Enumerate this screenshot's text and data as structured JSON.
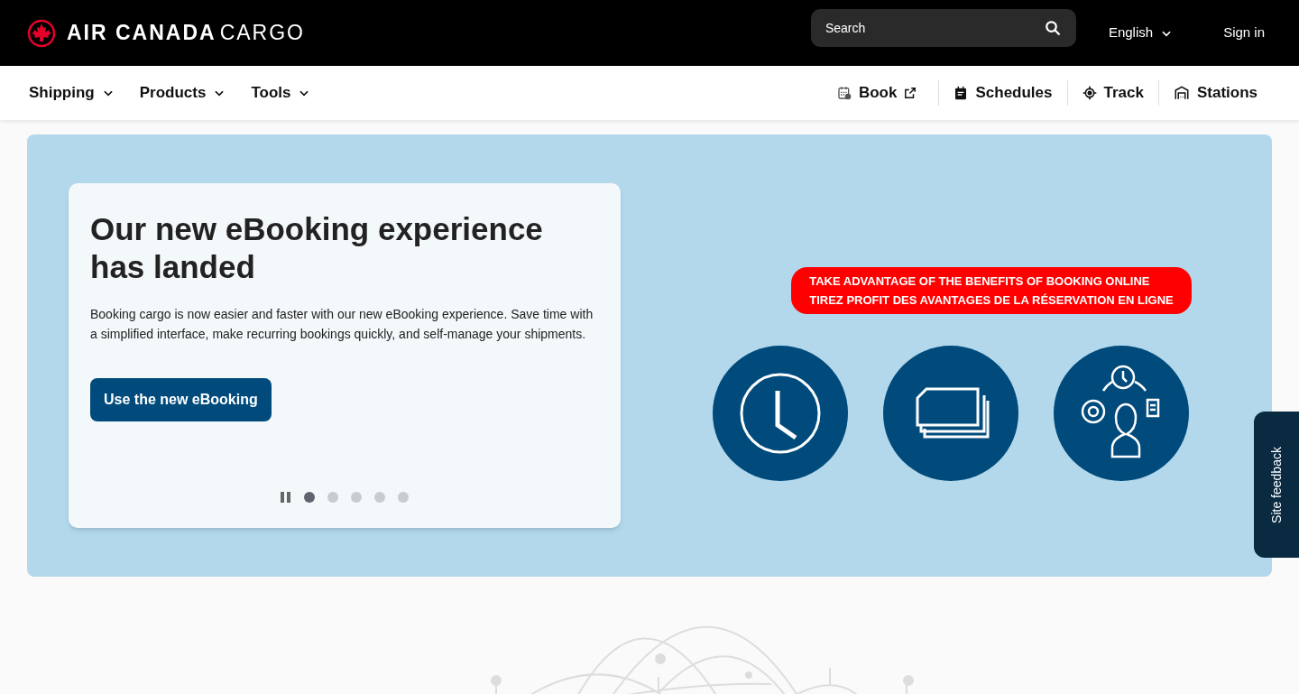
{
  "header": {
    "logo_text": "AIR CANADA",
    "logo_suffix": "CARGO",
    "search": {
      "placeholder": "Search"
    },
    "language": "English",
    "sign_in": "Sign in"
  },
  "nav": {
    "menus": [
      {
        "label": "Shipping"
      },
      {
        "label": "Products"
      },
      {
        "label": "Tools"
      }
    ],
    "links": [
      {
        "label": "Book",
        "kind": "book",
        "external": true
      },
      {
        "label": "Schedules",
        "kind": "schedules",
        "external": false
      },
      {
        "label": "Track",
        "kind": "track",
        "external": false
      },
      {
        "label": "Stations",
        "kind": "stations",
        "external": false
      }
    ]
  },
  "hero": {
    "title": "Our new eBooking experience has landed",
    "body": "Booking cargo is now easier and faster with our new eBooking experience. Save time with a simplified interface, make recurring bookings quickly, and self-manage your shipments.",
    "button": "Use the new eBooking",
    "slides": [
      {
        "selected": true
      },
      {
        "selected": false
      },
      {
        "selected": false
      },
      {
        "selected": false
      },
      {
        "selected": false
      }
    ],
    "banner": {
      "lines": [
        "TAKE ADVANTAGE OF THE BENEFITS OF BOOKING ONLINE",
        "TIREZ PROFIT DES AVANTAGES DE LA RÉSERVATION EN LIGNE"
      ],
      "icons": [
        {
          "kind": "clock"
        },
        {
          "kind": "documents"
        },
        {
          "kind": "person"
        }
      ]
    }
  },
  "feedback": "Site feedback"
}
